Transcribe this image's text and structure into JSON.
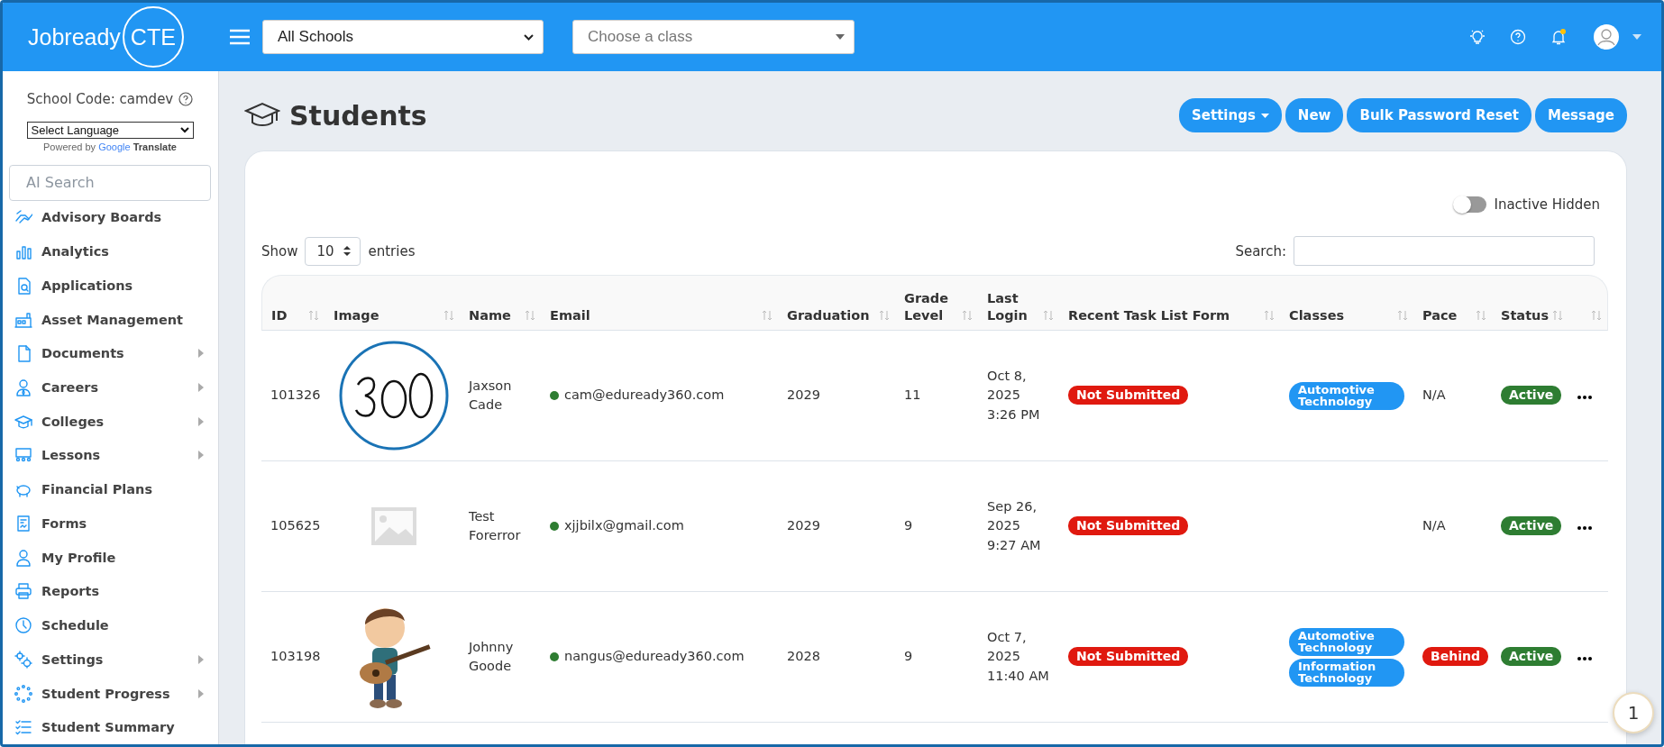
{
  "topbar": {
    "logo_left": "Jobready",
    "logo_right": "CTE",
    "school_select": "All Schools",
    "class_select": {
      "placeholder": "Choose a class"
    },
    "notification_dot": true
  },
  "sidebar": {
    "school_code": "School Code: camdev",
    "language_select": "Select Language",
    "powered_by": "Powered by",
    "google": "Google",
    "translate": "Translate",
    "search": {
      "placeholder": "AI Search"
    },
    "items": [
      {
        "label": "Advisory Boards",
        "submenu": false
      },
      {
        "label": "Analytics",
        "submenu": false
      },
      {
        "label": "Applications",
        "submenu": false
      },
      {
        "label": "Asset Management",
        "submenu": false
      },
      {
        "label": "Documents",
        "submenu": true
      },
      {
        "label": "Careers",
        "submenu": true
      },
      {
        "label": "Colleges",
        "submenu": true
      },
      {
        "label": "Lessons",
        "submenu": true
      },
      {
        "label": "Financial Plans",
        "submenu": false
      },
      {
        "label": "Forms",
        "submenu": false
      },
      {
        "label": "My Profile",
        "submenu": false
      },
      {
        "label": "Reports",
        "submenu": false
      },
      {
        "label": "Schedule",
        "submenu": false
      },
      {
        "label": "Settings",
        "submenu": true
      },
      {
        "label": "Student Progress",
        "submenu": true
      },
      {
        "label": "Student Summary",
        "submenu": false
      }
    ]
  },
  "page": {
    "title": "Students",
    "buttons": [
      {
        "label": "Settings",
        "kind": "dropdown"
      },
      {
        "label": "New",
        "kind": "plain"
      },
      {
        "label": "Bulk Password Reset",
        "kind": "plain"
      },
      {
        "label": "Message",
        "kind": "plain"
      }
    ],
    "inactive_toggle": {
      "label": "Inactive Hidden",
      "on": false
    },
    "show_label": "Show",
    "entries_value": "10",
    "entries_label": "entries",
    "search_label": "Search:"
  },
  "table": {
    "columns": [
      "ID",
      "Image",
      "Name",
      "Email",
      "Graduation",
      "Grade Level",
      "Last Login",
      "Recent Task List Form",
      "Classes",
      "Pace",
      "Status"
    ],
    "rows": [
      {
        "id": "101326",
        "name": "Jaxson Cade",
        "email": "cam@eduready360.com",
        "email_dot": true,
        "graduation": "2029",
        "grade": "11",
        "last_login": "Oct 8, 2025 3:26 PM",
        "task_form": {
          "label": "Not Submitted",
          "color": "#e0190f"
        },
        "classes": [
          "Automotive Technology"
        ],
        "pace": {
          "text": "N/A",
          "kind": "plain"
        },
        "status": {
          "label": "Active",
          "color": "#2e7d32"
        }
      },
      {
        "id": "105625",
        "name": "Test Forerror",
        "email": "xjjbilx@gmail.com",
        "email_dot": true,
        "graduation": "2029",
        "grade": "9",
        "last_login": "Sep 26, 2025 9:27 AM",
        "task_form": {
          "label": "Not Submitted",
          "color": "#e0190f"
        },
        "pace": {
          "text": "N/A",
          "kind": "plain"
        },
        "status": {
          "label": "Active",
          "color": "#2e7d32"
        }
      },
      {
        "id": "103198",
        "name": "Johnny Goode",
        "email": "nangus@eduready360.com",
        "email_dot": true,
        "graduation": "2028",
        "grade": "9",
        "last_login": "Oct 7, 2025 11:40 AM",
        "task_form": {
          "label": "Not Submitted",
          "color": "#e0190f"
        },
        "classes": [
          "Automotive Technology",
          "Information Technology"
        ],
        "pace": {
          "text": "Behind",
          "kind": "badge",
          "color": "#e0190f"
        },
        "status": {
          "label": "Active",
          "color": "#2e7d32"
        }
      }
    ]
  },
  "floating_badge": "1"
}
